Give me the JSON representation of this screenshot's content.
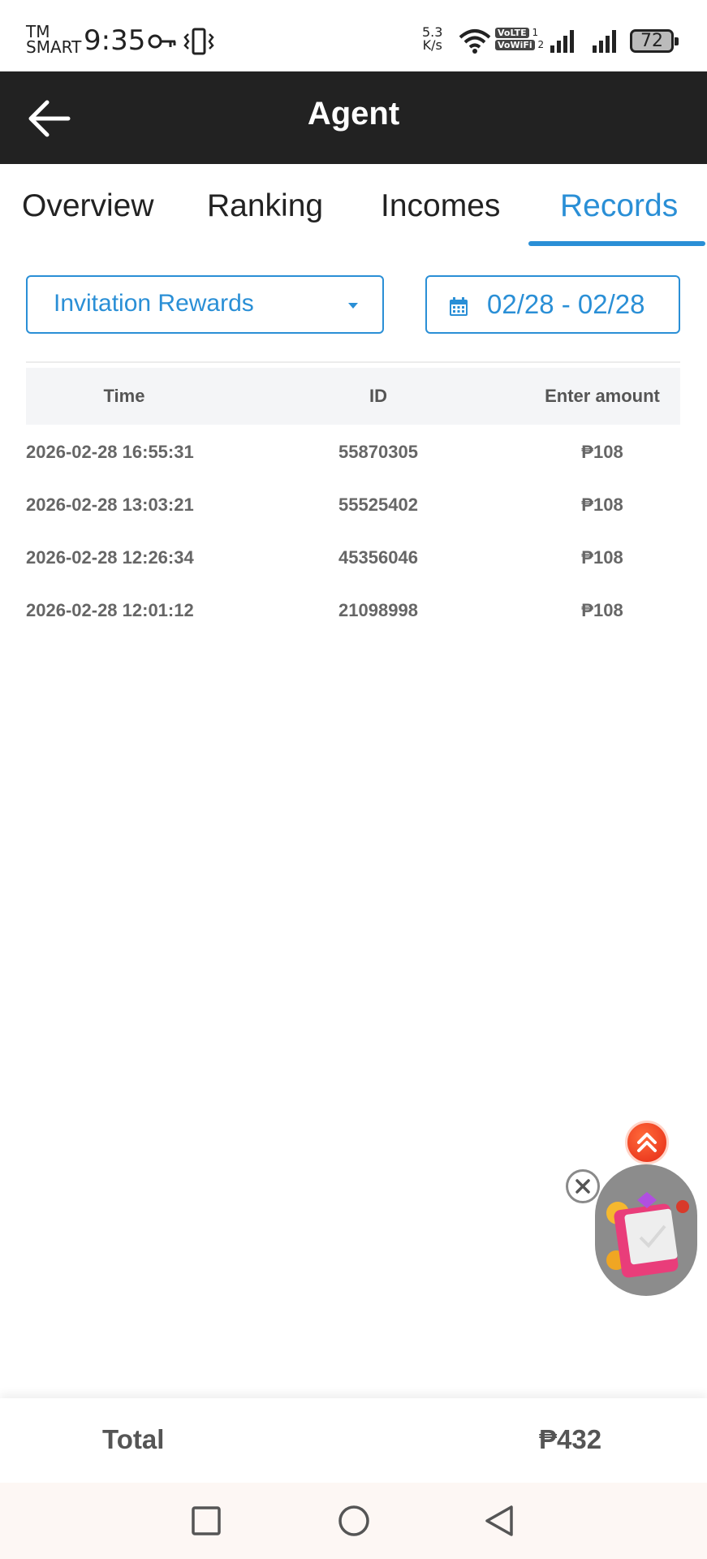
{
  "status_bar": {
    "carrier_line1": "TM",
    "carrier_line2": "SMART",
    "time": "9:35",
    "net_speed_value": "5.3",
    "net_speed_unit": "K/s",
    "volte1": "VoLTE",
    "volte1_sub": "1",
    "volte2": "VoWiFi",
    "volte2_sub": "2",
    "battery": "72",
    "icons": [
      "key-icon",
      "vibrate-icon",
      "wifi-icon",
      "signal-icon",
      "signal-icon",
      "battery-icon"
    ]
  },
  "header": {
    "title": "Agent",
    "back_icon": "arrow-left-icon"
  },
  "tabs": [
    {
      "label": "Overview",
      "active": false
    },
    {
      "label": "Ranking",
      "active": false
    },
    {
      "label": "Incomes",
      "active": false
    },
    {
      "label": "Records",
      "active": true
    }
  ],
  "filters": {
    "type_selected": "Invitation Rewards",
    "date_range": "02/28 - 02/28",
    "date_icon": "calendar-icon",
    "type_icon": "caret-down-icon"
  },
  "table": {
    "columns": [
      "Time",
      "ID",
      "Enter amount"
    ],
    "rows": [
      {
        "time": "2026-02-28 16:55:31",
        "id": "55870305",
        "amount": "₱108"
      },
      {
        "time": "2026-02-28 13:03:21",
        "id": "55525402",
        "amount": "₱108"
      },
      {
        "time": "2026-02-28 12:26:34",
        "id": "45356046",
        "amount": "₱108"
      },
      {
        "time": "2026-02-28 12:01:12",
        "id": "21098998",
        "amount": "₱108"
      }
    ]
  },
  "footer": {
    "total_label": "Total",
    "total_value": "₱432"
  },
  "colors": {
    "accent": "#2a8fd6",
    "header_bg": "#222222",
    "float_up": "#e52a16"
  },
  "nav": [
    "recents-square-icon",
    "home-circle-icon",
    "back-triangle-icon"
  ]
}
